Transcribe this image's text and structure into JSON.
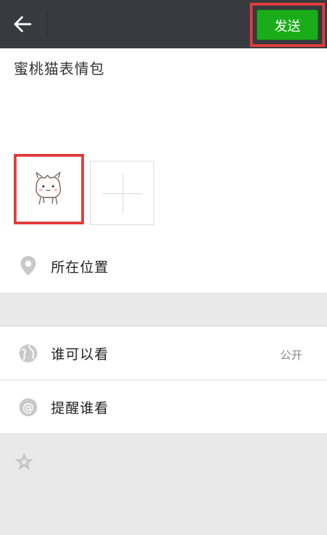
{
  "topbar": {
    "back_icon": "back-arrow-icon",
    "send_label": "发送",
    "send_color": "#1aad19"
  },
  "compose": {
    "text": "蜜桃猫表情包",
    "image_alt": "sticker-image",
    "add_icon": "plus-icon"
  },
  "options": {
    "location_label": "所在位置",
    "visibility_label": "谁可以看",
    "visibility_value": "公开",
    "mention_label": "提醒谁看"
  },
  "footer": {
    "star_icon": "star-icon"
  }
}
